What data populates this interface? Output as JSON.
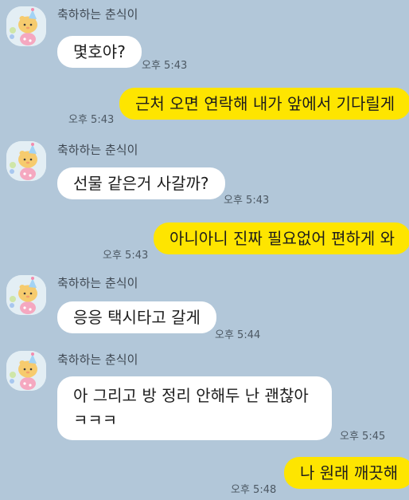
{
  "contact": {
    "name": "축하하는 춘식이"
  },
  "messages": [
    {
      "direction": "in",
      "text": "몇호야?",
      "time": "오후 5:43"
    },
    {
      "direction": "out",
      "text": "근처 오면 연락해 내가 앞에서 기다릴게",
      "time": "오후 5:43"
    },
    {
      "direction": "in",
      "text": "선물 같은거 사갈까?",
      "time": "오후 5:43"
    },
    {
      "direction": "out",
      "text": "아니아니 진짜 필요없어 편하게 와",
      "time": "오후 5:43"
    },
    {
      "direction": "in",
      "text": "응응 택시타고 갈게",
      "time": "오후 5:44"
    },
    {
      "direction": "in",
      "text": "아 그리고 방 정리 안해두 난 괜찮아 ㅋㅋㅋ",
      "time": "오후 5:45"
    },
    {
      "direction": "out",
      "text": "나 원래 깨끗해",
      "time": "오후 5:48"
    }
  ],
  "colors": {
    "background": "#b2c7d9",
    "incoming_bubble": "#ffffff",
    "outgoing_bubble": "#fee500"
  },
  "icons": {
    "avatar": "chunsik-party-hat-avatar"
  }
}
